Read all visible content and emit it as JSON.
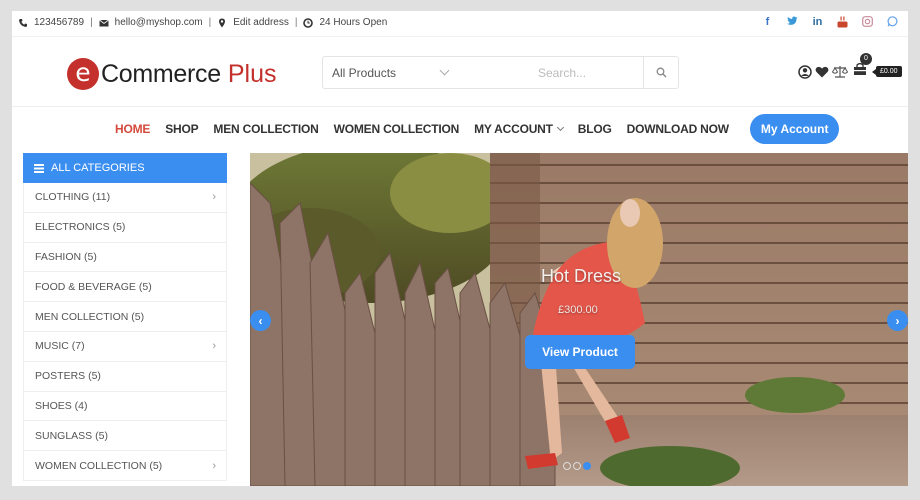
{
  "topbar": {
    "phone": "123456789",
    "email": "hello@myshop.com",
    "address": "Edit address",
    "hours": "24 Hours Open",
    "separator": "|",
    "social": [
      {
        "name": "facebook-icon",
        "glyph": "f",
        "color": "#3b75c4"
      },
      {
        "name": "twitter-icon",
        "glyph": "t",
        "color": "#3a9ad9"
      },
      {
        "name": "linkedin-icon",
        "glyph": "in",
        "color": "#2d6da3"
      },
      {
        "name": "youtube-icon",
        "glyph": "▶",
        "color": "#c9462c"
      },
      {
        "name": "instagram-icon",
        "glyph": "◎",
        "color": "#c78a9a"
      },
      {
        "name": "whatsapp-icon",
        "glyph": "◔",
        "color": "#6aa6e8"
      }
    ]
  },
  "header": {
    "logo": {
      "letter": "e",
      "name": "Commerce",
      "accent": "Plus",
      "accent_color": "#c4302b"
    },
    "search": {
      "category": "All Products",
      "placeholder": "Search..."
    },
    "cart": {
      "count": "0",
      "total": "£0.00"
    }
  },
  "nav": {
    "items": [
      {
        "label": "HOME",
        "active": true
      },
      {
        "label": "SHOP"
      },
      {
        "label": "MEN COLLECTION"
      },
      {
        "label": "WOMEN COLLECTION"
      },
      {
        "label": "MY ACCOUNT",
        "dropdown": true
      },
      {
        "label": "BLOG"
      },
      {
        "label": "DOWNLOAD NOW"
      }
    ],
    "account_button": "My Account",
    "accent_color": "#3a8ef0"
  },
  "sidebar": {
    "title": "ALL CATEGORIES",
    "categories": [
      {
        "label": "CLOTHING (11)",
        "has_sub": true
      },
      {
        "label": "ELECTRONICS (5)",
        "has_sub": false
      },
      {
        "label": "FASHION (5)",
        "has_sub": false
      },
      {
        "label": "FOOD & BEVERAGE (5)",
        "has_sub": false
      },
      {
        "label": "MEN COLLECTION (5)",
        "has_sub": false
      },
      {
        "label": "MUSIC (7)",
        "has_sub": true
      },
      {
        "label": "POSTERS (5)",
        "has_sub": false
      },
      {
        "label": "SHOES (4)",
        "has_sub": false
      },
      {
        "label": "SUNGLASS (5)",
        "has_sub": false
      },
      {
        "label": "WOMEN COLLECTION (5)",
        "has_sub": true
      }
    ],
    "arrow_glyph": "›"
  },
  "slider": {
    "title": "Hot Dress",
    "price": "£300.00",
    "button": "View Product",
    "prev_glyph": "‹",
    "next_glyph": "›",
    "slide_count": 3,
    "active_slide": 3
  }
}
